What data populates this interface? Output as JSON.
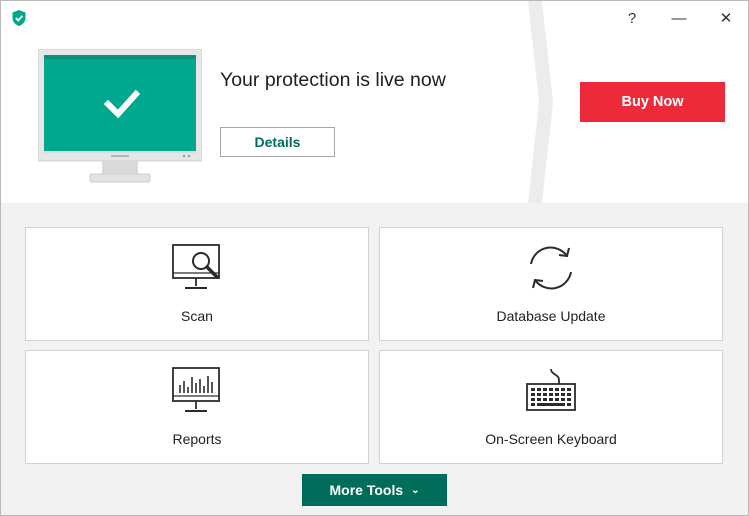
{
  "titlebar": {
    "help_label": "?",
    "minimize_label": "—",
    "close_label": "✕"
  },
  "status": {
    "headline": "Your protection is live now",
    "details_label": "Details",
    "buy_label": "Buy Now"
  },
  "tiles": [
    {
      "label": "Scan",
      "icon": "scan-icon"
    },
    {
      "label": "Database Update",
      "icon": "update-icon"
    },
    {
      "label": "Reports",
      "icon": "reports-icon"
    },
    {
      "label": "On-Screen Keyboard",
      "icon": "keyboard-icon"
    }
  ],
  "more_tools": {
    "label": "More Tools",
    "chevron": "⌄"
  },
  "colors": {
    "accent": "#006d5b",
    "brand_teal": "#00a88e",
    "buy": "#ec2a3a"
  }
}
